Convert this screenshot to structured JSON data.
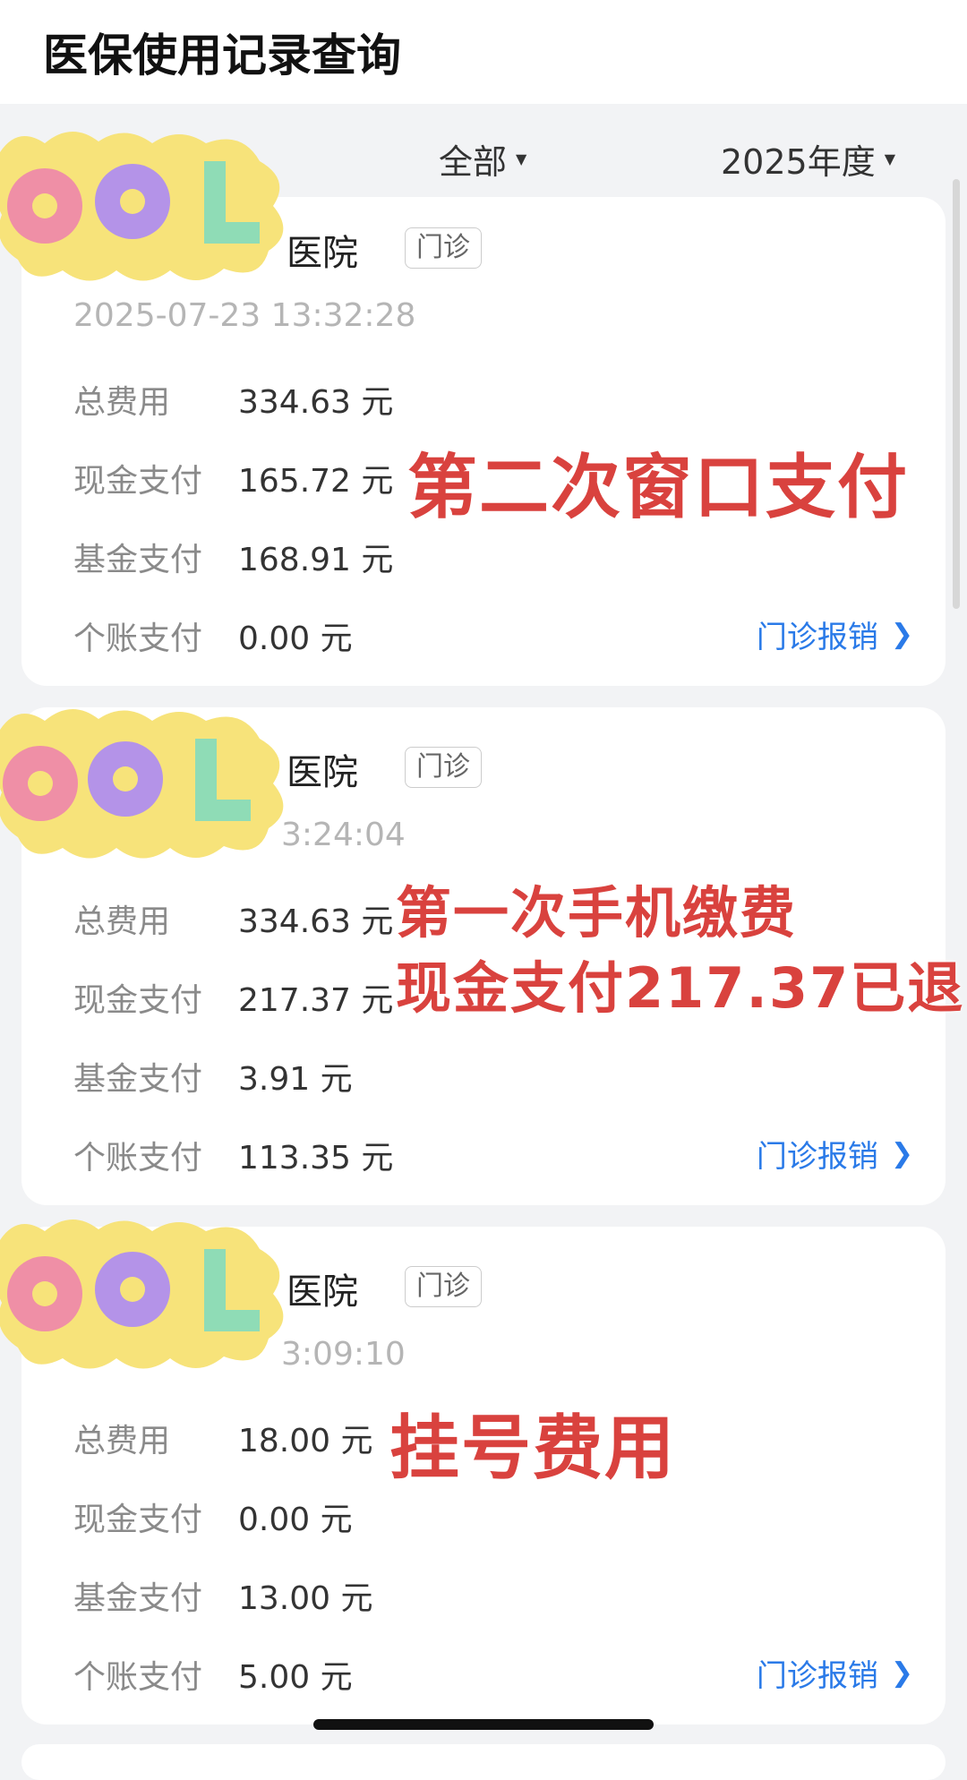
{
  "header": {
    "title": "医保使用记录查询"
  },
  "filters": {
    "type": "全部",
    "year": "2025年度"
  },
  "records": [
    {
      "hospital": "医院",
      "tag": "门诊",
      "time": "2025-07-23 13:32:28",
      "rows": [
        {
          "label": "总费用",
          "value": "334.63 元"
        },
        {
          "label": "现金支付",
          "value": "165.72 元"
        },
        {
          "label": "基金支付",
          "value": "168.91 元"
        },
        {
          "label": "个账支付",
          "value": "0.00 元"
        }
      ],
      "link": "门诊报销",
      "annotation": "第二次窗口支付"
    },
    {
      "hospital": "医院",
      "tag": "门诊",
      "time": "3:24:04",
      "rows": [
        {
          "label": "总费用",
          "value": "334.63 元"
        },
        {
          "label": "现金支付",
          "value": "217.37 元"
        },
        {
          "label": "基金支付",
          "value": "3.91 元"
        },
        {
          "label": "个账支付",
          "value": "113.35 元"
        }
      ],
      "link": "门诊报销",
      "annotation_line1": "第一次手机缴费",
      "annotation_line2": "现金支付217.37已退"
    },
    {
      "hospital": "医院",
      "tag": "门诊",
      "time": "3:09:10",
      "rows": [
        {
          "label": "总费用",
          "value": "18.00 元"
        },
        {
          "label": "现金支付",
          "value": "0.00 元"
        },
        {
          "label": "基金支付",
          "value": "13.00 元"
        },
        {
          "label": "个账支付",
          "value": "5.00 元"
        }
      ],
      "link": "门诊报销",
      "annotation": "挂号费用"
    }
  ],
  "sticker_text": "COOL",
  "colors": {
    "accent_link": "#2a7ae8",
    "annotation": "#d9423e",
    "sticker_bg": "#f7e37a"
  }
}
